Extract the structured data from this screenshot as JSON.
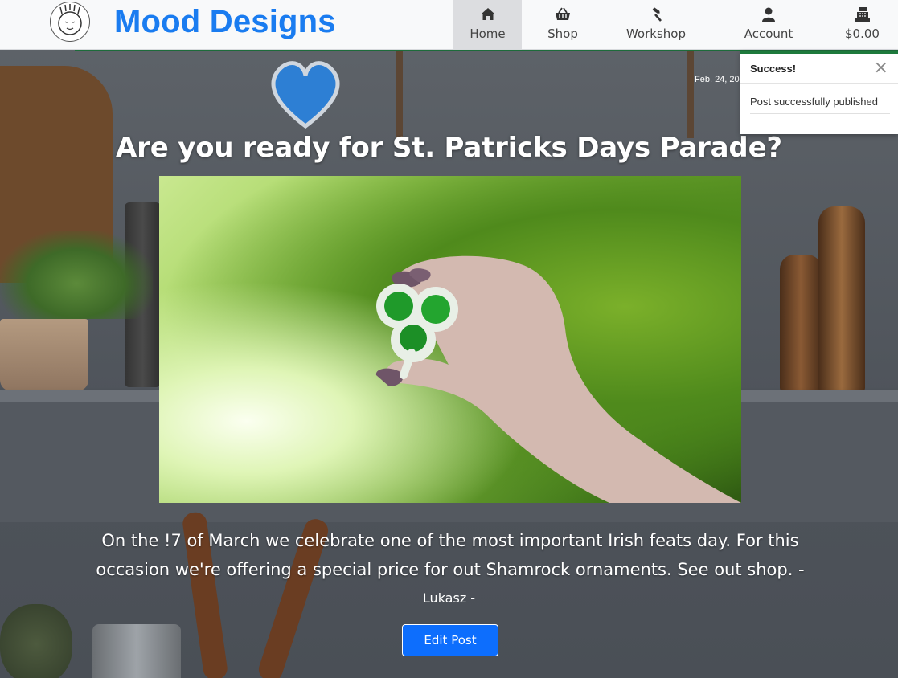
{
  "navbar": {
    "brand": "Mood Designs",
    "items": [
      {
        "label": "Home",
        "icon": "home-icon",
        "active": true
      },
      {
        "label": "Shop",
        "icon": "basket-icon",
        "active": false
      },
      {
        "label": "Workshop",
        "icon": "hammer-icon",
        "active": false
      },
      {
        "label": "Account",
        "icon": "user-icon",
        "active": false
      },
      {
        "label": "$0.00",
        "icon": "cash-register-icon",
        "active": false
      }
    ]
  },
  "toast": {
    "title": "Success!",
    "close": "×",
    "message": "Post successfully published"
  },
  "post": {
    "date": "Feb. 24, 20",
    "title": "Are you ready for St. Patricks Days Parade?",
    "content": "On the !7 of March we celebrate one of the most important Irish feats day. For this occasion we're offering a special price for out Shamrock ornaments. See out shop. -",
    "author": "Lukasz -",
    "edit_label": "Edit Post"
  },
  "colors": {
    "brand": "#1a7cf0",
    "primary_button": "#0d6efd",
    "toast_accent": "#1d7a3c"
  }
}
